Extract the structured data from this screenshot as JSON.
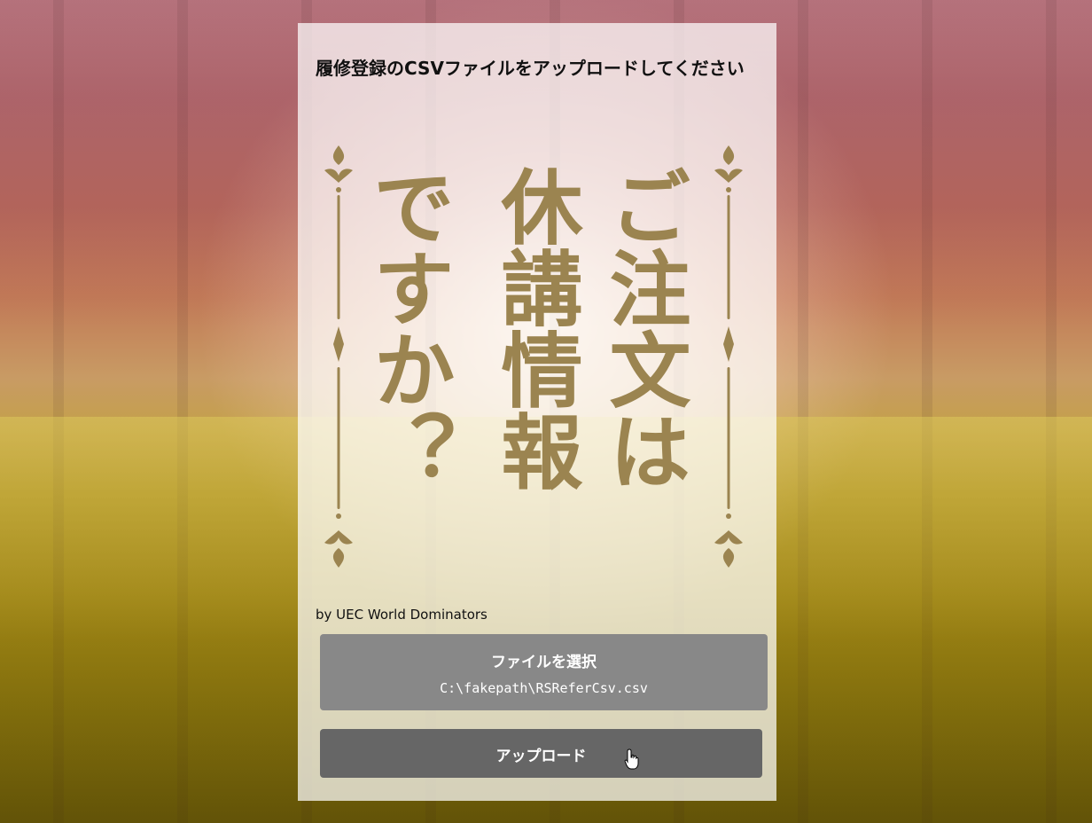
{
  "page": {
    "title": "履修登録のCSVファイルをアップロードしてください",
    "byline": "by UEC World Dominators"
  },
  "logo": {
    "columns": [
      "ご注文は",
      "休講情報",
      "ですか？"
    ],
    "color": "#9b8450"
  },
  "file_input": {
    "button_label": "ファイルを選択",
    "selected_path": "C:\\fakepath\\RSReferCsv.csv"
  },
  "upload": {
    "button_label": "アップロード"
  },
  "icons": {
    "cursor": "hand-pointer-icon"
  }
}
